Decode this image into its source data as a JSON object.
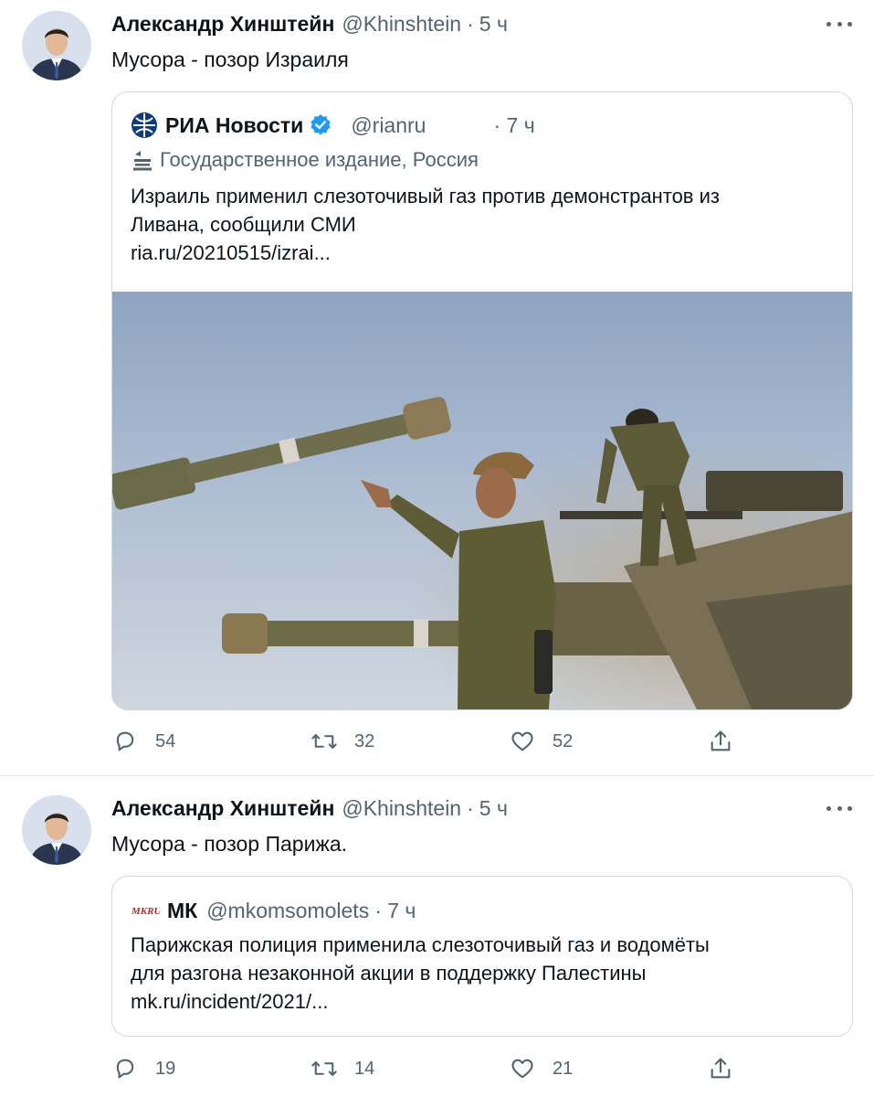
{
  "tweets": [
    {
      "author": {
        "name": "Александр Хинштейн",
        "handle": "@Khinshtein",
        "separator": "·",
        "time": "5 ч"
      },
      "text": "Мусора - позор Израиля",
      "quote": {
        "name": "РИА Новости",
        "handle": "@rianru",
        "time": "· 7 ч",
        "label": "Государственное издание, Россия",
        "lines": [
          "Израиль применил слезоточивый газ против демонстрантов из",
          "Ливана, сообщили СМИ",
          "ria.ru/20210515/izrai..."
        ]
      },
      "counts": {
        "replies": "54",
        "retweets": "32",
        "likes": "52"
      }
    },
    {
      "author": {
        "name": "Александр Хинштейн",
        "handle": "@Khinshtein",
        "separator": "·",
        "time": "5 ч"
      },
      "text": "Мусора - позор Парижа.",
      "quote": {
        "name": "МК",
        "handle": "@mkomsomolets",
        "time": "· 7 ч",
        "logo_text": "MKRU",
        "lines": [
          "Парижская полиция применила слезоточивый газ и водомёты",
          "для разгона незаконной акции в поддержку Палестины",
          "mk.ru/incident/2021/..."
        ]
      },
      "counts": {
        "replies": "19",
        "retweets": "14",
        "likes": "21"
      }
    }
  ],
  "icons": [
    "avatar",
    "more-icon",
    "ria-logo-icon",
    "verified-icon",
    "state-media-icon",
    "mk-logo-icon",
    "reply-icon",
    "retweet-icon",
    "like-icon",
    "share-icon"
  ],
  "colors": {
    "text": "#0f1419",
    "secondary": "#536471",
    "verified": "#1d9bf0",
    "border": "#cfd9de"
  }
}
